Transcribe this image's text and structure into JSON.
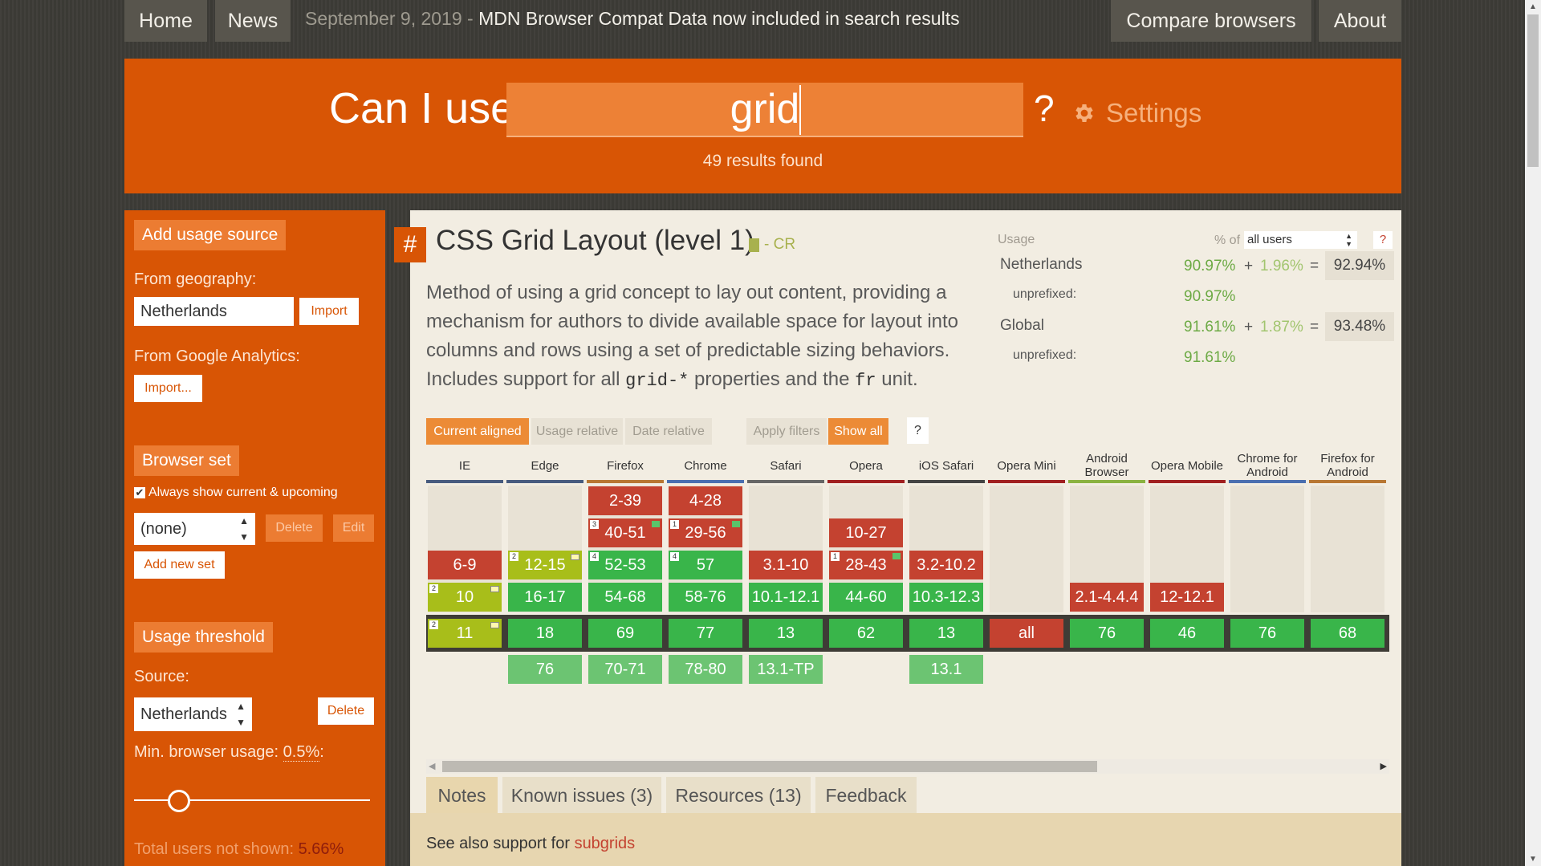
{
  "nav": {
    "home": "Home",
    "news": "News",
    "news_date": "September 9, 2019 - ",
    "news_text": "MDN Browser Compat Data now included in search results",
    "compare": "Compare browsers",
    "about": "About"
  },
  "search": {
    "prefix": "Can I use",
    "value": "grid",
    "help": "?",
    "settings": "Settings",
    "results": "49 results found"
  },
  "sidebar": {
    "add_usage_source": "Add usage source",
    "from_geography": "From geography:",
    "geography_value": "Netherlands",
    "import": "Import",
    "from_ga": "From Google Analytics:",
    "ga_import": "Import...",
    "browser_set": "Browser set",
    "always_show": "Always show current & upcoming",
    "set_value": "(none)",
    "delete": "Delete",
    "edit": "Edit",
    "add_new_set": "Add new set",
    "usage_threshold": "Usage threshold",
    "source_label": "Source:",
    "source_value": "Netherlands",
    "source_delete": "Delete",
    "min_usage_prefix": "Min. browser usage: ",
    "min_usage_value": "0.5%",
    "min_usage_suffix": ":",
    "slider_fraction": 0.19,
    "total_not_shown_label": "Total users not shown: ",
    "total_not_shown_value": "5.66%"
  },
  "feature": {
    "hash": "#",
    "title": "CSS Grid Layout (level 1)",
    "status": "- CR",
    "desc_1": "Method of using a grid concept to lay out content, providing a mechanism for authors to divide available space for layout into columns and rows using a set of predictable sizing behaviors. Includes support for all ",
    "code_1": "grid-*",
    "desc_2": " properties and the ",
    "code_2": "fr",
    "desc_3": " unit."
  },
  "usage": {
    "label": "Usage",
    "pct_of": "% of",
    "users_select": "all users",
    "help": "?",
    "nl_name": "Netherlands",
    "nl_a": "90.97%",
    "nl_b": "1.96%",
    "nl_total": "92.94%",
    "nl_unprefixed_label": "unprefixed:",
    "nl_unprefixed": "90.97%",
    "gl_name": "Global",
    "gl_a": "91.61%",
    "gl_b": "1.87%",
    "gl_total": "93.48%",
    "gl_unprefixed_label": "unprefixed:",
    "gl_unprefixed": "91.61%",
    "plus": "+",
    "equals": "="
  },
  "filters": {
    "current_aligned": "Current aligned",
    "usage_relative": "Usage relative",
    "date_relative": "Date relative",
    "apply_filters": "Apply filters",
    "show_all": "Show all",
    "help": "?"
  },
  "browsers": {
    "ie": "IE",
    "edge": "Edge",
    "firefox": "Firefox",
    "chrome": "Chrome",
    "safari": "Safari",
    "opera": "Opera",
    "ios_safari": "iOS Safari",
    "opera_mini": "Opera Mini",
    "android_browser": "Android Browser",
    "opera_mobile": "Opera Mobile",
    "chrome_android": "Chrome for Android",
    "firefox_android": "Firefox for Android"
  },
  "cells": {
    "ie_1": "6-9",
    "ie_2": "10",
    "ie_cur": "11",
    "edge_1": "12-15",
    "edge_2": "16-17",
    "edge_cur": "18",
    "edge_f": "76",
    "ff_1": "2-39",
    "ff_2": "40-51",
    "ff_3": "52-53",
    "ff_4": "54-68",
    "ff_cur": "69",
    "ff_f": "70-71",
    "ch_1": "4-28",
    "ch_2": "29-56",
    "ch_3": "57",
    "ch_4": "58-76",
    "ch_cur": "77",
    "ch_f": "78-80",
    "sa_1": "3.1-10",
    "sa_2": "10.1-12.1",
    "sa_cur": "13",
    "sa_f": "13.1-TP",
    "op_1": "10-27",
    "op_2": "28-43",
    "op_3": "44-60",
    "op_cur": "62",
    "ios_1": "3.2-10.2",
    "ios_2": "10.3-12.3",
    "ios_cur": "13",
    "ios_f": "13.1",
    "om_cur": "all",
    "ab_1": "2.1-4.4.4",
    "ab_cur": "76",
    "omob_1": "12-12.1",
    "omob_cur": "46",
    "cfa_cur": "76",
    "ffa_cur": "68",
    "n2": "2",
    "n3": "3",
    "n4": "4",
    "n1": "1"
  },
  "tabs": {
    "notes": "Notes",
    "known_issues": "Known issues (3)",
    "resources": "Resources (13)",
    "feedback": "Feedback",
    "see_also": "See also support for ",
    "subgrids": "subgrids"
  },
  "colors": {
    "brand_orange": "#d85505",
    "supported": "#39b54a",
    "unsupported": "#c44230",
    "partial": "#a8be1a"
  }
}
